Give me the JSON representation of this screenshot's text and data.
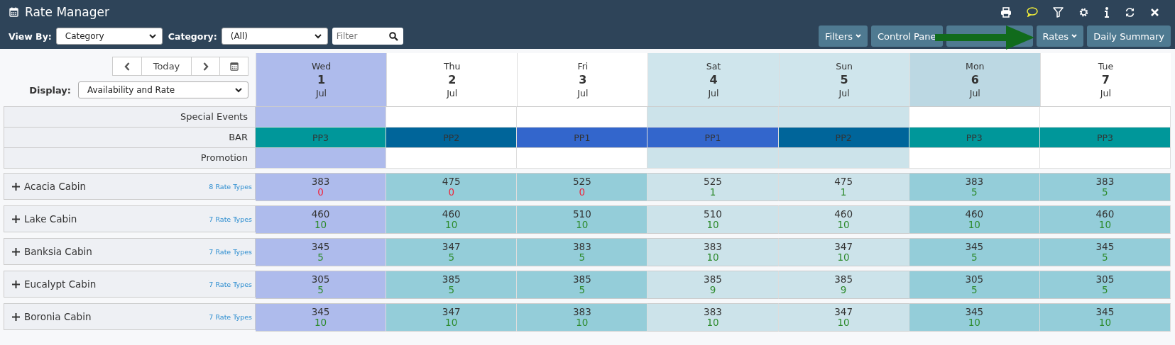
{
  "window": {
    "title": "Rate Manager"
  },
  "toolbar": {
    "view_by_label": "View By:",
    "view_by": "Category",
    "category_label": "Category:",
    "category": "(All)",
    "filter_placeholder": "Filter",
    "buttons": [
      {
        "kind": "labeled",
        "label": "Filters",
        "dropdown": true
      },
      {
        "kind": "labeled",
        "label": "Control Pane",
        "dropdown": false
      },
      {
        "kind": "covered"
      },
      {
        "kind": "labeled",
        "label": "Rates",
        "dropdown": true
      },
      {
        "kind": "labeled",
        "label": "Daily Summary",
        "dropdown": false
      }
    ]
  },
  "nav": {
    "today": "Today",
    "display_label": "Display:",
    "display": "Availability and Rate"
  },
  "days": [
    {
      "weekday": "Wed",
      "day": "1",
      "month": "Jul",
      "kind": "today",
      "highlighted": false
    },
    {
      "weekday": "Thu",
      "day": "2",
      "month": "Jul",
      "kind": "weekday",
      "highlighted": false
    },
    {
      "weekday": "Fri",
      "day": "3",
      "month": "Jul",
      "kind": "weekday",
      "highlighted": false
    },
    {
      "weekday": "Sat",
      "day": "4",
      "month": "Jul",
      "kind": "weekend",
      "highlighted": false
    },
    {
      "weekday": "Sun",
      "day": "5",
      "month": "Jul",
      "kind": "weekend",
      "highlighted": false
    },
    {
      "weekday": "Mon",
      "day": "6",
      "month": "Jul",
      "kind": "weekday",
      "highlighted": true
    },
    {
      "weekday": "Tue",
      "day": "7",
      "month": "Jul",
      "kind": "weekday",
      "highlighted": false
    }
  ],
  "special_events_label": "Special Events",
  "promotion_label": "Promotion",
  "bar_label": "BAR",
  "bar": [
    {
      "label": "PP3",
      "color": "#00979a"
    },
    {
      "label": "PP2",
      "color": "#00659a"
    },
    {
      "label": "PP1",
      "color": "#3366cc"
    },
    {
      "label": "PP1",
      "color": "#3366cc"
    },
    {
      "label": "PP2",
      "color": "#00659a"
    },
    {
      "label": "PP3",
      "color": "#00979a"
    },
    {
      "label": "PP3",
      "color": "#00979a"
    }
  ],
  "rooms": [
    {
      "name": "Acacia Cabin",
      "rate_types": "8 Rate Types",
      "cells": [
        {
          "rate": "383",
          "avail": "0",
          "sold_out": true
        },
        {
          "rate": "475",
          "avail": "0",
          "sold_out": true
        },
        {
          "rate": "525",
          "avail": "0",
          "sold_out": true
        },
        {
          "rate": "525",
          "avail": "1",
          "sold_out": false
        },
        {
          "rate": "475",
          "avail": "1",
          "sold_out": false
        },
        {
          "rate": "383",
          "avail": "5",
          "sold_out": false
        },
        {
          "rate": "383",
          "avail": "5",
          "sold_out": false
        }
      ]
    },
    {
      "name": "Lake Cabin",
      "rate_types": "7 Rate Types",
      "cells": [
        {
          "rate": "460",
          "avail": "10",
          "sold_out": false
        },
        {
          "rate": "460",
          "avail": "10",
          "sold_out": false
        },
        {
          "rate": "510",
          "avail": "10",
          "sold_out": false
        },
        {
          "rate": "510",
          "avail": "10",
          "sold_out": false
        },
        {
          "rate": "460",
          "avail": "10",
          "sold_out": false
        },
        {
          "rate": "460",
          "avail": "10",
          "sold_out": false
        },
        {
          "rate": "460",
          "avail": "10",
          "sold_out": false
        }
      ]
    },
    {
      "name": "Banksia Cabin",
      "rate_types": "7 Rate Types",
      "cells": [
        {
          "rate": "345",
          "avail": "5",
          "sold_out": false
        },
        {
          "rate": "347",
          "avail": "5",
          "sold_out": false
        },
        {
          "rate": "383",
          "avail": "5",
          "sold_out": false
        },
        {
          "rate": "383",
          "avail": "10",
          "sold_out": false
        },
        {
          "rate": "347",
          "avail": "10",
          "sold_out": false
        },
        {
          "rate": "345",
          "avail": "5",
          "sold_out": false
        },
        {
          "rate": "345",
          "avail": "5",
          "sold_out": false
        }
      ]
    },
    {
      "name": "Eucalypt Cabin",
      "rate_types": "7 Rate Types",
      "cells": [
        {
          "rate": "305",
          "avail": "5",
          "sold_out": false
        },
        {
          "rate": "385",
          "avail": "5",
          "sold_out": false
        },
        {
          "rate": "385",
          "avail": "5",
          "sold_out": false
        },
        {
          "rate": "385",
          "avail": "9",
          "sold_out": false
        },
        {
          "rate": "385",
          "avail": "9",
          "sold_out": false
        },
        {
          "rate": "305",
          "avail": "5",
          "sold_out": false
        },
        {
          "rate": "305",
          "avail": "5",
          "sold_out": false
        }
      ]
    },
    {
      "name": "Boronia Cabin",
      "rate_types": "7 Rate Types",
      "cells": [
        {
          "rate": "345",
          "avail": "10",
          "sold_out": false
        },
        {
          "rate": "347",
          "avail": "10",
          "sold_out": false
        },
        {
          "rate": "383",
          "avail": "10",
          "sold_out": false
        },
        {
          "rate": "383",
          "avail": "10",
          "sold_out": false
        },
        {
          "rate": "347",
          "avail": "10",
          "sold_out": false
        },
        {
          "rate": "345",
          "avail": "10",
          "sold_out": false
        },
        {
          "rate": "345",
          "avail": "10",
          "sold_out": false
        }
      ]
    }
  ]
}
